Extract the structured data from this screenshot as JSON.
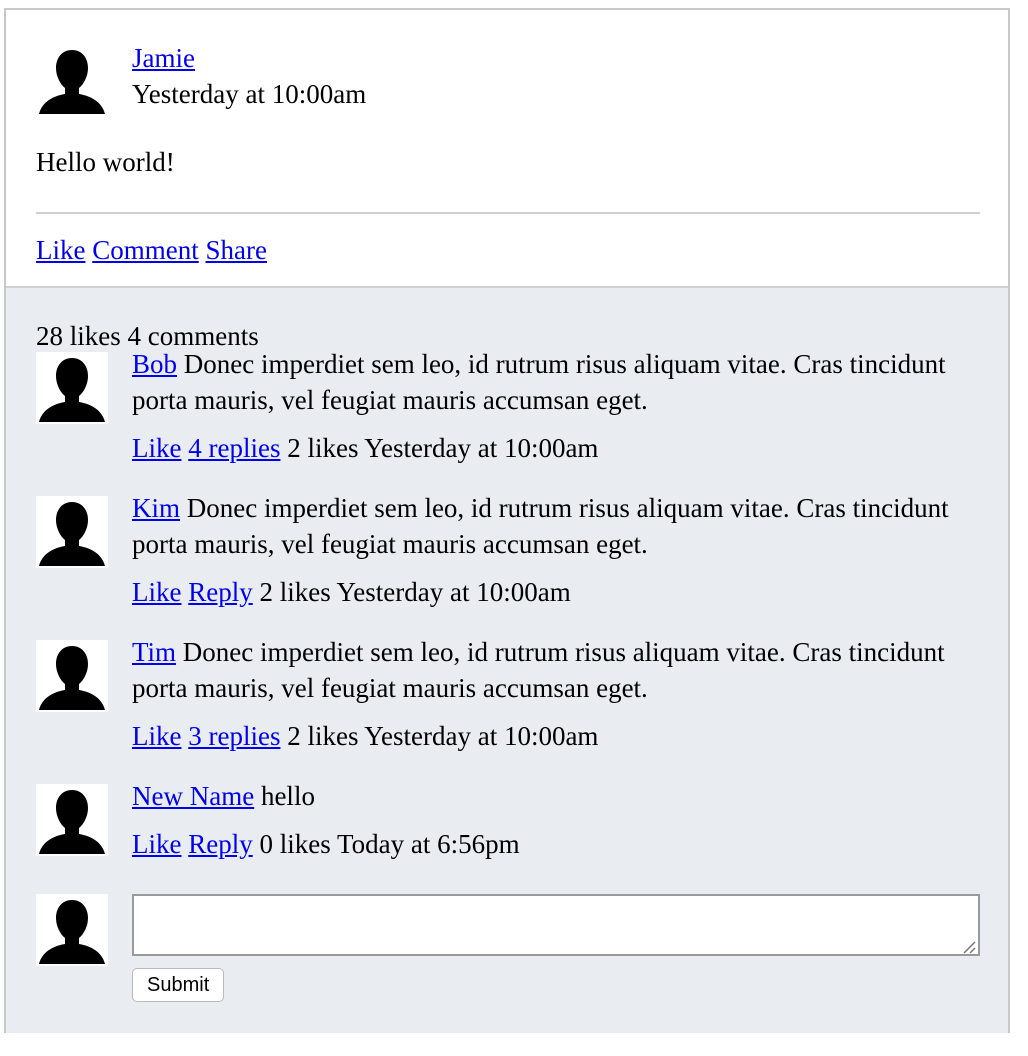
{
  "post": {
    "author": "Jamie",
    "time": "Yesterday at 10:00am",
    "text": "Hello world!",
    "actions": {
      "like": "Like",
      "comment": "Comment",
      "share": "Share"
    }
  },
  "stats": {
    "likes": "28 likes",
    "comments": "4 comments"
  },
  "comments": [
    {
      "author": "Bob",
      "text": "Donec imperdiet sem leo, id rutrum risus aliquam vitae. Cras tincidunt porta mauris, vel feugiat mauris accumsan eget.",
      "like_label": "Like",
      "reply_label": "4 replies",
      "likes": "2 likes",
      "time": "Yesterday at 10:00am"
    },
    {
      "author": "Kim",
      "text": "Donec imperdiet sem leo, id rutrum risus aliquam vitae. Cras tincidunt porta mauris, vel feugiat mauris accumsan eget.",
      "like_label": "Like",
      "reply_label": "Reply",
      "likes": "2 likes",
      "time": "Yesterday at 10:00am"
    },
    {
      "author": "Tim",
      "text": "Donec imperdiet sem leo, id rutrum risus aliquam vitae. Cras tincidunt porta mauris, vel feugiat mauris accumsan eget.",
      "like_label": "Like",
      "reply_label": "3 replies",
      "likes": "2 likes",
      "time": "Yesterday at 10:00am"
    },
    {
      "author": "New Name",
      "text": "hello",
      "like_label": "Like",
      "reply_label": "Reply",
      "likes": "0 likes",
      "time": "Today at 6:56pm"
    }
  ],
  "reply_form": {
    "value": "",
    "submit_label": "Submit"
  },
  "icons": {
    "avatar": "user-silhouette-icon"
  }
}
